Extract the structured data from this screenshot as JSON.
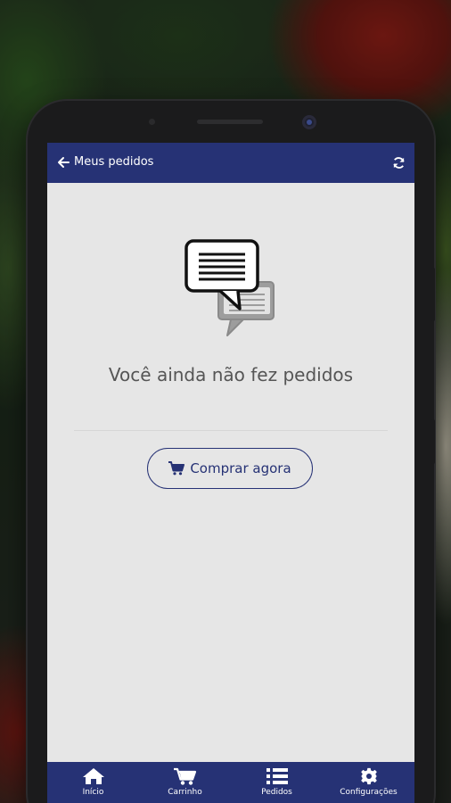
{
  "appbar": {
    "title": "Meus pedidos",
    "back_icon": "arrow-left-icon",
    "refresh_icon": "refresh-icon"
  },
  "empty_state": {
    "icon": "chat-bubbles-icon",
    "message": "Você ainda não fez pedidos"
  },
  "buy_button": {
    "icon": "cart-icon",
    "label": "Comprar agora"
  },
  "bottom_nav": {
    "items": [
      {
        "label": "Início",
        "icon": "home-icon"
      },
      {
        "label": "Carrinho",
        "icon": "cart-icon"
      },
      {
        "label": "Pedidos",
        "icon": "list-icon"
      },
      {
        "label": "Configurações",
        "icon": "gear-icon"
      }
    ]
  },
  "colors": {
    "primary": "#263275",
    "background": "#e6e6e6",
    "text_muted": "#555555"
  }
}
